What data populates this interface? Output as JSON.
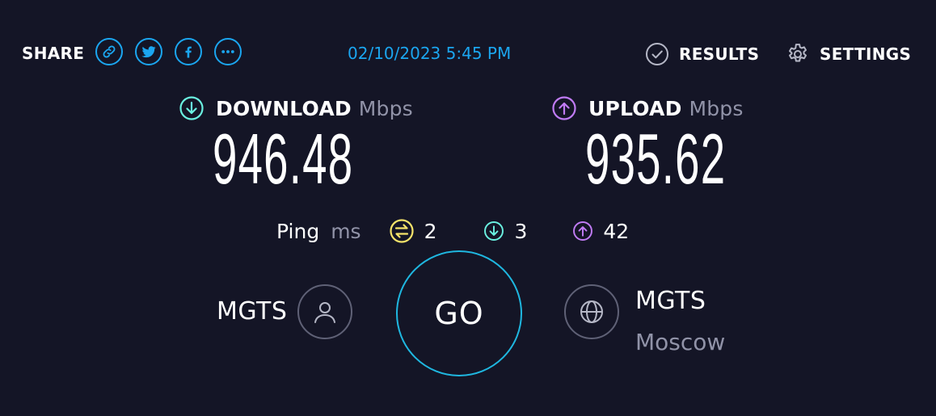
{
  "header": {
    "share_label": "SHARE",
    "share_buttons": [
      {
        "icon": "link-icon"
      },
      {
        "icon": "twitter-icon"
      },
      {
        "icon": "facebook-icon"
      },
      {
        "icon": "more-icon"
      }
    ],
    "datetime": "02/10/2023 5:45 PM",
    "results_label": "RESULTS",
    "settings_label": "SETTINGS"
  },
  "download": {
    "label": "DOWNLOAD",
    "unit": "Mbps",
    "value": "946.48",
    "icon_color": "#6af0e0"
  },
  "upload": {
    "label": "UPLOAD",
    "unit": "Mbps",
    "value": "935.62",
    "icon_color": "#c07bf5"
  },
  "ping": {
    "label": "Ping",
    "unit": "ms",
    "idle": "2",
    "download": "3",
    "upload": "42",
    "idle_color": "#f5e36a"
  },
  "provider": {
    "name": "MGTS"
  },
  "go_button": {
    "label": "GO"
  },
  "server": {
    "name": "MGTS",
    "location": "Moscow"
  },
  "colors": {
    "background": "#141526",
    "accent": "#1ba6f0",
    "muted": "#9193a8"
  }
}
